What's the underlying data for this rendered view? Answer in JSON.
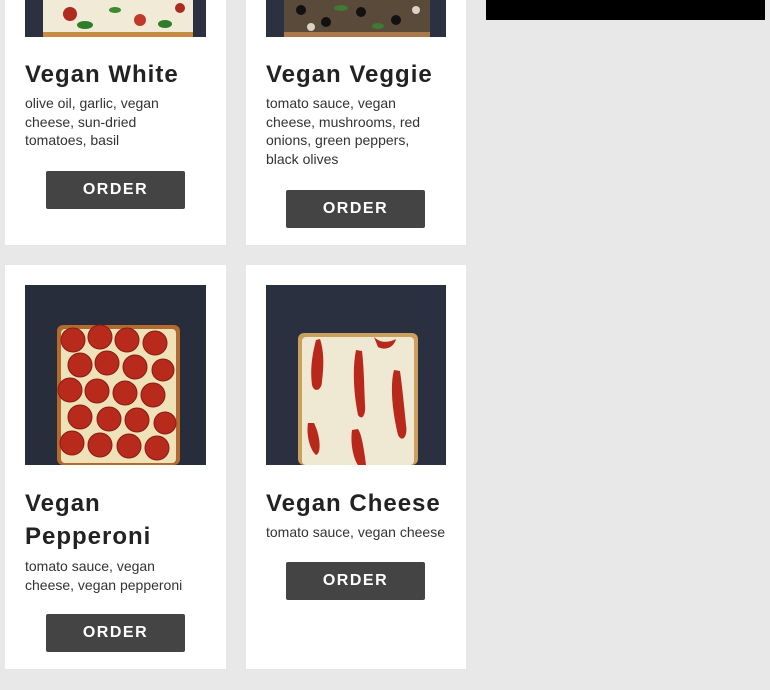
{
  "items": [
    {
      "title": "Vegan White",
      "desc": "olive oil, garlic, vegan cheese, sun-dried tomatoes, basil",
      "order_label": "ORDER"
    },
    {
      "title": "Vegan Veggie",
      "desc": "tomato sauce, vegan cheese, mushrooms, red onions, green peppers, black olives",
      "order_label": "ORDER"
    },
    {
      "title": "Vegan Pepperoni",
      "desc": "tomato sauce, vegan cheese, vegan pepperoni",
      "order_label": "ORDER"
    },
    {
      "title": "Vegan Cheese",
      "desc": "tomato sauce, vegan cheese",
      "order_label": "ORDER"
    }
  ]
}
